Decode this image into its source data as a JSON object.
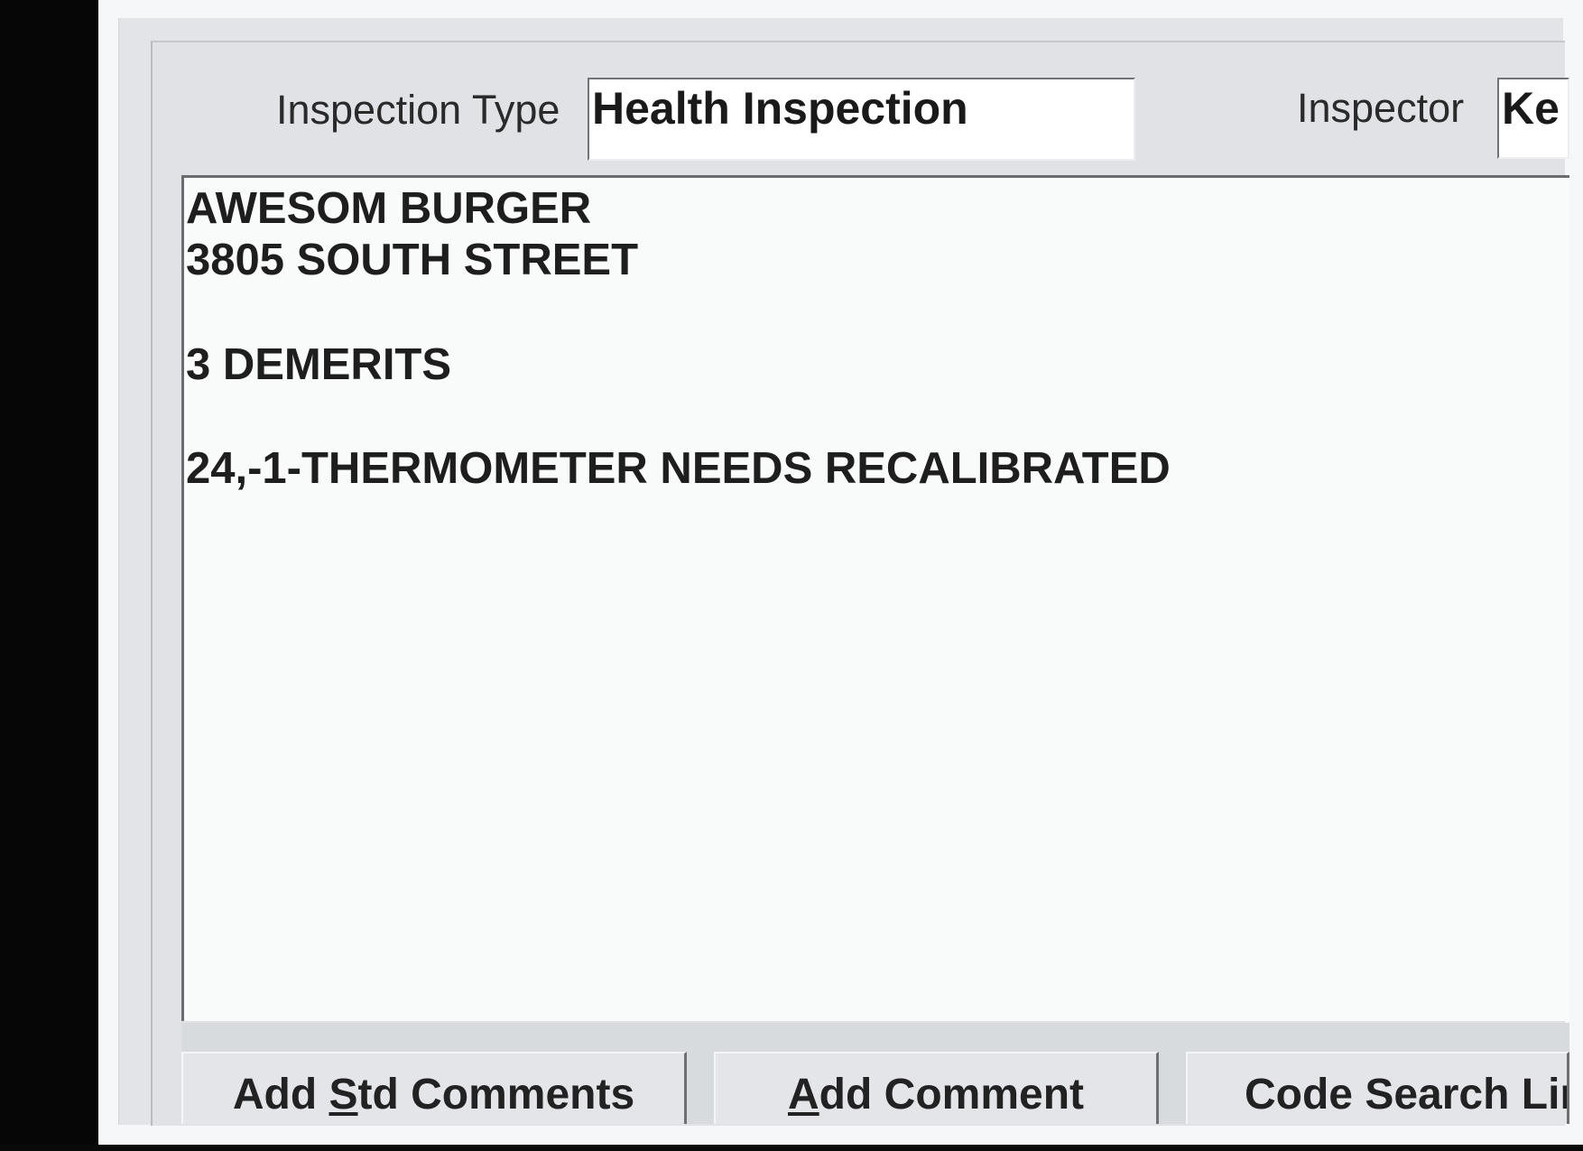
{
  "form": {
    "inspection_type_label": "Inspection Type",
    "inspection_type_value": "Health Inspection",
    "inspector_label": "Inspector",
    "inspector_value": "Ke"
  },
  "comments": {
    "lines": [
      "AWESOM BURGER",
      "3805 SOUTH STREET",
      "3 DEMERITS",
      "24,-1-THERMOMETER NEEDS RECALIBRATED"
    ]
  },
  "buttons": {
    "add_std_comments": {
      "pre": "Add ",
      "mnemonic": "S",
      "post": "td Comments"
    },
    "add_comment": {
      "pre": "",
      "mnemonic": "A",
      "post": "dd Comment"
    },
    "code_search": {
      "label": "Code Search Lir"
    }
  }
}
